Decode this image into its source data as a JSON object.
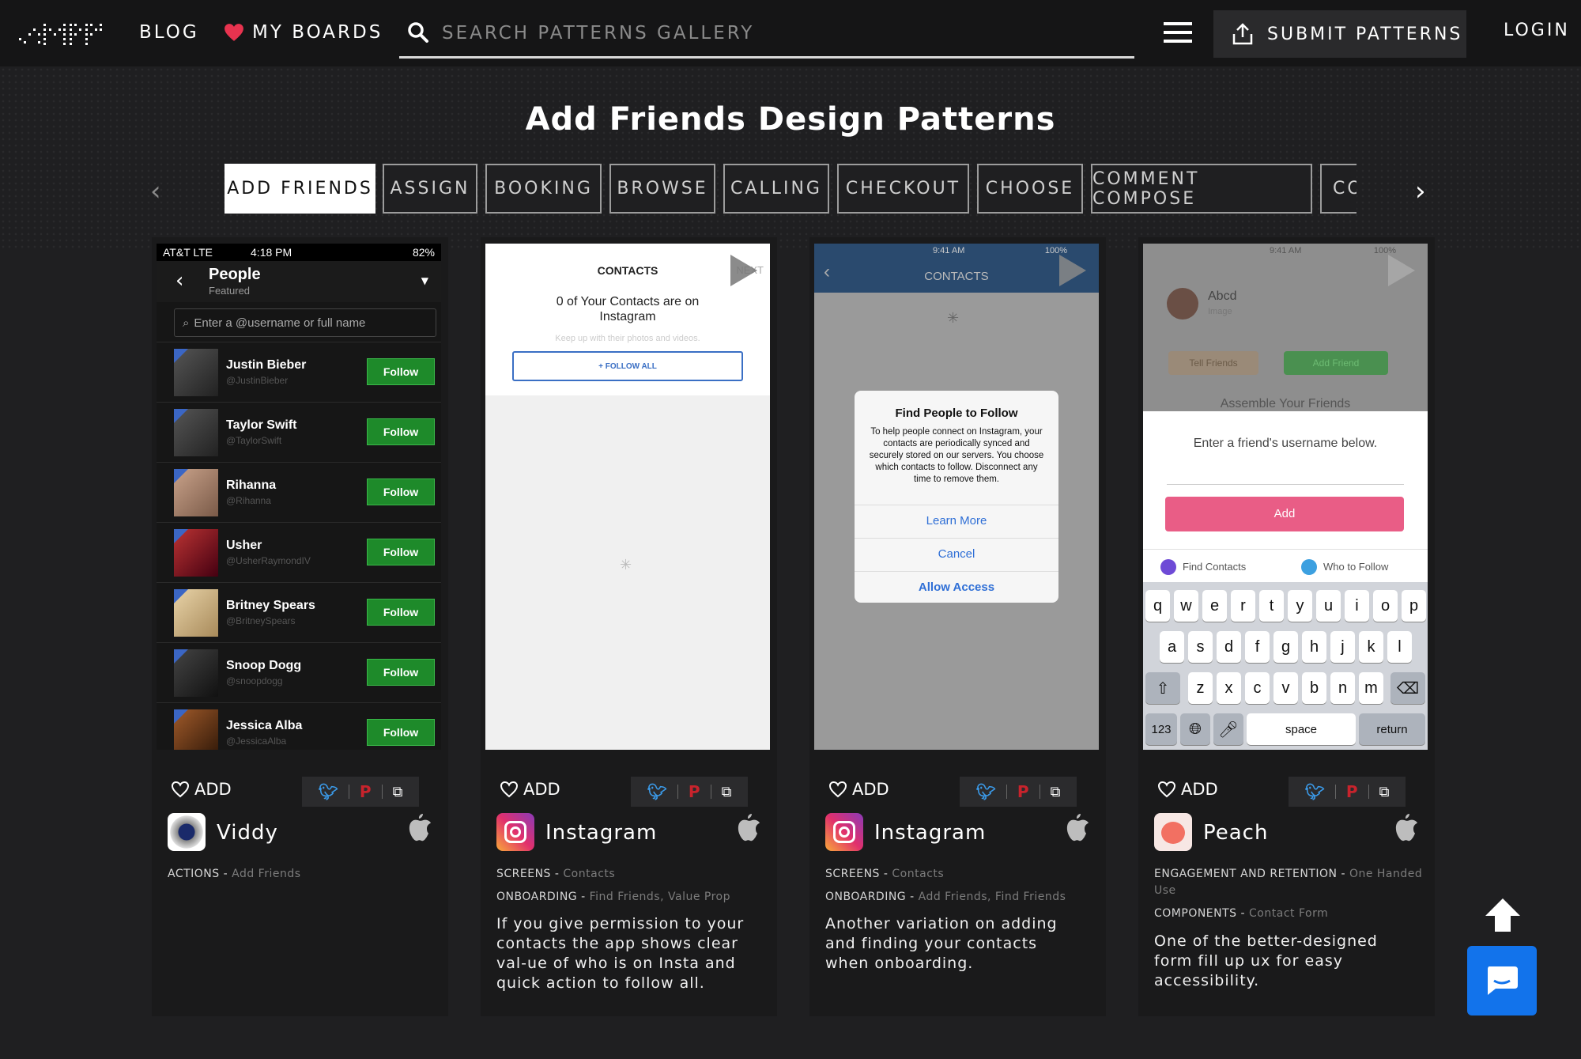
{
  "header": {
    "blog_label": "BLOG",
    "boards_label": "MY BOARDS",
    "search_placeholder": "SEARCH PATTERNS GALLERY",
    "submit_label": "SUBMIT PATTERNS",
    "login_label": "LOGIN"
  },
  "page_title": "Add Friends Design Patterns",
  "tabs": [
    "ADD FRIENDS",
    "ASSIGN",
    "BOOKING",
    "BROWSE",
    "CALLING",
    "CHECKOUT",
    "CHOOSE",
    "COMMENT COMPOSE",
    "CO"
  ],
  "active_tab": "ADD FRIENDS",
  "add_label": "ADD",
  "cards": [
    {
      "app": "Viddy",
      "meta": [
        {
          "k": "ACTIONS",
          "v": "Add Friends"
        }
      ],
      "description": "",
      "screen": {
        "carrier": "AT&T  LTE",
        "time": "4:18 PM",
        "battery": "82%",
        "title": "People",
        "subtitle": "Featured",
        "search_placeholder": "Enter a @username or full name",
        "follow_label": "Follow",
        "people": [
          {
            "name": "Justin Bieber",
            "handle": "@JustinBieber"
          },
          {
            "name": "Taylor Swift",
            "handle": "@TaylorSwift"
          },
          {
            "name": "Rihanna",
            "handle": "@Rihanna"
          },
          {
            "name": "Usher",
            "handle": "@UsherRaymondIV"
          },
          {
            "name": "Britney Spears",
            "handle": "@BritneySpears"
          },
          {
            "name": "Snoop Dogg",
            "handle": "@snoopdogg"
          },
          {
            "name": "Jessica Alba",
            "handle": "@JessicaAlba"
          }
        ]
      }
    },
    {
      "app": "Instagram",
      "meta": [
        {
          "k": "SCREENS",
          "v": "Contacts"
        },
        {
          "k": "ONBOARDING",
          "v": "Find Friends, Value Prop"
        }
      ],
      "description": "If you give permission to your contacts the app shows clear val-ue of who is on Insta and quick action to follow all.",
      "screen": {
        "title": "CONTACTS",
        "next": "NEXT",
        "headline": "0 of Your Contacts are on Instagram",
        "sub": "Keep up with their photos and videos.",
        "button": "+ FOLLOW ALL"
      }
    },
    {
      "app": "Instagram",
      "meta": [
        {
          "k": "SCREENS",
          "v": "Contacts"
        },
        {
          "k": "ONBOARDING",
          "v": "Add Friends, Find Friends"
        }
      ],
      "description": "Another variation on adding and finding your contacts when onboarding.",
      "screen": {
        "time": "9:41 AM",
        "battery": "100%",
        "title": "CONTACTS",
        "dialog_title": "Find People to Follow",
        "dialog_body": "To help people connect on Instagram, your contacts are periodically synced and securely stored on our servers. You choose which contacts to follow. Disconnect any time to remove them.",
        "learn_more": "Learn More",
        "cancel": "Cancel",
        "allow": "Allow Access"
      }
    },
    {
      "app": "Peach",
      "meta": [
        {
          "k": "ENGAGEMENT AND RETENTION",
          "v": "One Handed Use"
        },
        {
          "k": "COMPONENTS",
          "v": "Contact Form"
        }
      ],
      "description": "One of the better-designed form fill up ux for easy accessibility.",
      "screen": {
        "time": "9:41 AM",
        "battery": "100%",
        "contact_name": "Abcd",
        "contact_sub": "Image",
        "tell_friends": "Tell Friends",
        "add_friend": "Add Friend",
        "assemble": "Assemble Your Friends",
        "prompt": "Enter a friend's username below.",
        "add_button": "Add",
        "find_contacts": "Find Contacts",
        "who_to_follow": "Who to Follow",
        "row1": [
          "q",
          "w",
          "e",
          "r",
          "t",
          "y",
          "u",
          "i",
          "o",
          "p"
        ],
        "row2": [
          "a",
          "s",
          "d",
          "f",
          "g",
          "h",
          "j",
          "k",
          "l"
        ],
        "row3": [
          "z",
          "x",
          "c",
          "v",
          "b",
          "n",
          "m"
        ],
        "num_key": "123",
        "space_key": "space",
        "return_key": "return"
      }
    }
  ]
}
